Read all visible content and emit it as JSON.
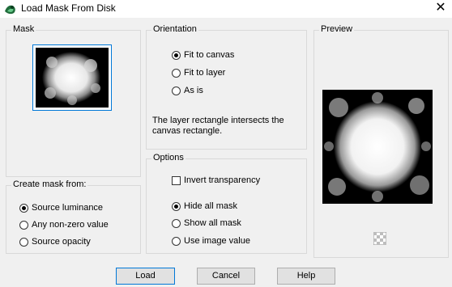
{
  "window": {
    "title": "Load Mask From Disk",
    "close_glyph": "✕"
  },
  "mask": {
    "label": "Mask"
  },
  "create_from": {
    "label": "Create mask from:",
    "options": [
      "Source luminance",
      "Any non-zero value",
      "Source opacity"
    ],
    "selected": 0
  },
  "orientation": {
    "label": "Orientation",
    "options": [
      "Fit to canvas",
      "Fit to layer",
      "As is"
    ],
    "selected": 0,
    "info": "The layer rectangle intersects the canvas rectangle."
  },
  "options": {
    "label": "Options",
    "invert_label": "Invert transparency",
    "invert_checked": false,
    "mask_options": [
      "Hide all mask",
      "Show all mask",
      "Use image value"
    ],
    "selected": 0
  },
  "preview": {
    "label": "Preview"
  },
  "buttons": {
    "load": "Load",
    "cancel": "Cancel",
    "help": "Help"
  },
  "colors": {
    "accent": "#0078d7",
    "dialog_bg": "#f0f0f0"
  }
}
